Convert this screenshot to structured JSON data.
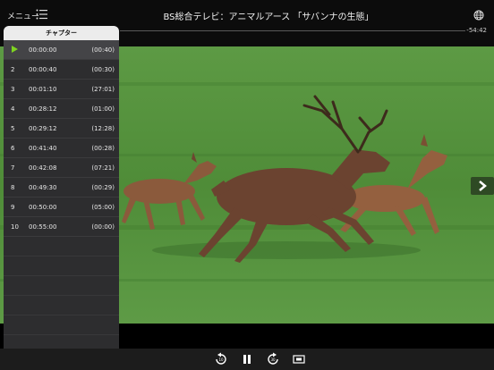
{
  "header": {
    "menu_label": "メニュー",
    "title": "BS総合テレビ：アニマルアース 「サバンナの生態」",
    "time_remaining": "-54:42"
  },
  "chapters_panel": {
    "title": "チャプター",
    "items": [
      {
        "num": "1",
        "time": "00:00:00",
        "duration": "(00:40)",
        "active": true
      },
      {
        "num": "2",
        "time": "00:00:40",
        "duration": "(00:30)"
      },
      {
        "num": "3",
        "time": "00:01:10",
        "duration": "(27:01)"
      },
      {
        "num": "4",
        "time": "00:28:12",
        "duration": "(01:00)"
      },
      {
        "num": "5",
        "time": "00:29:12",
        "duration": "(12:28)"
      },
      {
        "num": "6",
        "time": "00:41:40",
        "duration": "(00:28)"
      },
      {
        "num": "7",
        "time": "00:42:08",
        "duration": "(07:21)"
      },
      {
        "num": "8",
        "time": "00:49:30",
        "duration": "(00:29)"
      },
      {
        "num": "9",
        "time": "00:50:00",
        "duration": "(05:00)"
      },
      {
        "num": "10",
        "time": "00:55:00",
        "duration": "(00:00)"
      }
    ]
  },
  "controls": {
    "rewind_seconds": "10",
    "forward_seconds": "30"
  },
  "icons": {
    "menu": "list-icon",
    "globe": "globe-icon",
    "next": "chevron-right-icon",
    "rewind": "rewind-10-icon",
    "pause": "pause-icon",
    "forward": "forward-30-icon",
    "aspect": "aspect-ratio-icon"
  },
  "colors": {
    "accent": "#7ed321"
  }
}
